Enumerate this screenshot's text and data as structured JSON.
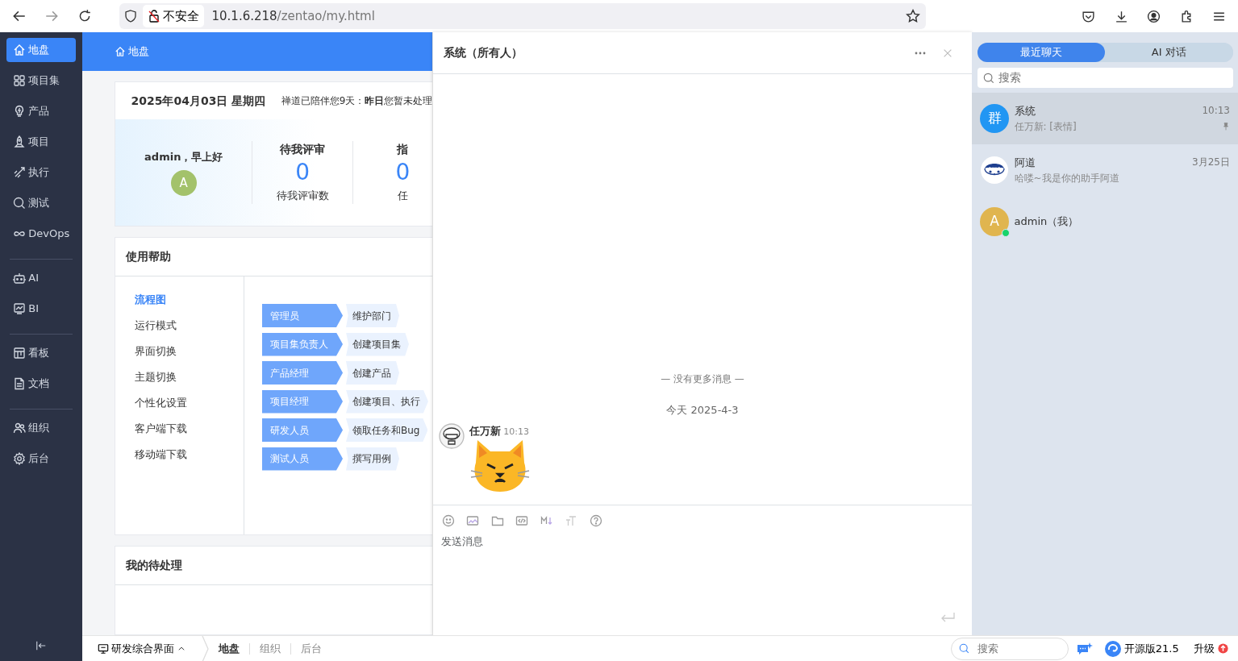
{
  "browser": {
    "security_label": "不安全",
    "url_host": "10.1.6.218",
    "url_path": "/zentao/my.html"
  },
  "sidebar": {
    "groups": [
      [
        {
          "label": "地盘",
          "selected": true
        },
        {
          "label": "项目集",
          "selected": false
        },
        {
          "label": "产品",
          "selected": false
        },
        {
          "label": "项目",
          "selected": false
        },
        {
          "label": "执行",
          "selected": false
        },
        {
          "label": "测试",
          "selected": false
        },
        {
          "label": "DevOps",
          "selected": false
        }
      ],
      [
        {
          "label": "AI",
          "selected": false
        },
        {
          "label": "BI",
          "selected": false
        }
      ],
      [
        {
          "label": "看板",
          "selected": false
        },
        {
          "label": "文档",
          "selected": false
        }
      ],
      [
        {
          "label": "组织",
          "selected": false
        },
        {
          "label": "后台",
          "selected": false
        }
      ]
    ]
  },
  "header": {
    "title": "地盘"
  },
  "welcome": {
    "date": "2025年04月03日 星期四",
    "notice": "禅道已陪伴您9天：**昨日**您暂未处理",
    "greeting": "admin，早上好",
    "avatar": "A",
    "stats": [
      {
        "title": "待我评审",
        "value": "0",
        "caption": "待我评审数"
      },
      {
        "title": "指",
        "value": "0",
        "caption": "任"
      }
    ]
  },
  "help": {
    "title": "使用帮助",
    "topics": [
      {
        "label": "流程图",
        "selected": true
      },
      {
        "label": "运行模式",
        "selected": false
      },
      {
        "label": "界面切换",
        "selected": false
      },
      {
        "label": "主题切换",
        "selected": false
      },
      {
        "label": "个性化设置",
        "selected": false
      },
      {
        "label": "客户端下载",
        "selected": false
      },
      {
        "label": "移动端下载",
        "selected": false
      }
    ],
    "flow": [
      {
        "role": "管理员",
        "task": "维护部门"
      },
      {
        "role": "项目集负责人",
        "task": "创建项目集"
      },
      {
        "role": "产品经理",
        "task": "创建产品"
      },
      {
        "role": "项目经理",
        "task": "创建项目、执行"
      },
      {
        "role": "研发人员",
        "task": "领取任务和Bug"
      },
      {
        "role": "测试人员",
        "task": "撰写用例"
      }
    ]
  },
  "todo": {
    "title": "我的待处理"
  },
  "chat": {
    "title": "系统（所有人）",
    "end_notice": "— 没有更多消息 —",
    "date_divider": "今天 2025-4-3",
    "messages": [
      {
        "sender": "任万新",
        "time": "10:13"
      }
    ],
    "composer": {
      "placeholder": "发送消息"
    }
  },
  "chat_list": {
    "tabs": [
      {
        "label": "最近聊天",
        "selected": true
      },
      {
        "label": "AI 对话",
        "selected": false
      }
    ],
    "search": {
      "placeholder": "搜索"
    },
    "conversations": [
      {
        "name": "系统",
        "preview": "任万新: [表情]",
        "time": "10:13",
        "selected": true,
        "pinned": true,
        "avatar_text": "群",
        "color": "#2196f3",
        "online": false
      },
      {
        "name": "阿道",
        "preview": "哈喽~我是你的助手阿道",
        "time": "3月25日",
        "selected": false,
        "pinned": false,
        "online": false
      },
      {
        "name": "admin（我）",
        "selected": false,
        "pinned": false,
        "avatar_text": "A",
        "color": "#e0b54f",
        "online": true
      }
    ]
  },
  "bottom_bar": {
    "menu": "研发综合界面",
    "tabs": [
      {
        "label": "地盘",
        "selected": true
      },
      {
        "label": "组织",
        "selected": false
      },
      {
        "label": "后台",
        "selected": false
      }
    ],
    "search": {
      "placeholder": "搜索"
    },
    "version": "开源版21.5",
    "upgrade": "升级"
  }
}
